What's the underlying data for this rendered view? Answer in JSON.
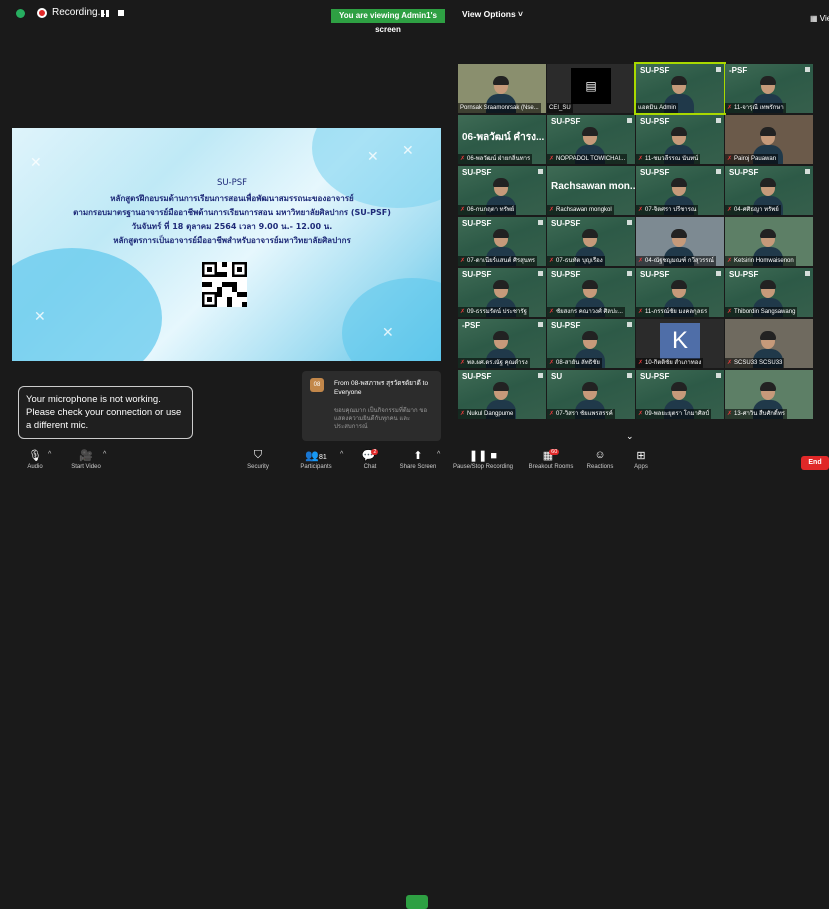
{
  "topbar": {
    "recording_label": "Recording...",
    "viewing_banner": "You are viewing Admin1's screen",
    "view_options": "View Options ˅",
    "view_right": "View"
  },
  "slide": {
    "code": "SU-PSF",
    "line1": "หลักสูตรฝึกอบรมด้านการเรียนการสอนเพื่อพัฒนาสมรรถนะของอาจารย์",
    "line2": "ตามกรอบมาตรฐานอาจารย์มืออาชีพด้านการเรียนการสอน มหาวิทยาลัยศิลปากร (SU-PSF)",
    "line3": "วันจันทร์ ที่ 18 ตุลาคม 2564 เวลา 9.00 น.- 12.00 น.",
    "line4": "หลักสูตรการเป็นอาจารย์มืออาชีพสำหรับอาจารย์มหาวิทยาลัยศิลปากร"
  },
  "participants": [
    {
      "label": "Pornsak Sraamonrsak (Nse...",
      "bg": "photo",
      "top": ""
    },
    {
      "label": "CEI_SU",
      "bg": "logo",
      "top": ""
    },
    {
      "label": "แอดมิน Admin",
      "bg": "green",
      "top": "SU-PSF"
    },
    {
      "label": "11-จารุณี เทพรักษา",
      "bg": "green",
      "top": "-PSF",
      "mic_off": true
    },
    {
      "label": "06-พลวัฒน์ ฝ่ายกลิ่นทาร",
      "bg": "name",
      "big": "06-พลวัฒน์ คำรง...",
      "mic_off": true
    },
    {
      "label": "NOPPADOL TOWICHAI...",
      "bg": "green",
      "top": "SU-PSF",
      "mic_off": true
    },
    {
      "label": "11-ชมวลีรรณ นันทน์",
      "bg": "green",
      "top": "SU-PSF",
      "mic_off": true
    },
    {
      "label": "Pairoj Pauawan",
      "bg": "photo",
      "top": "",
      "mic_off": true
    },
    {
      "label": "06-กนกฤตา ทรัพย์",
      "bg": "green",
      "top": "SU-PSF",
      "mic_off": true
    },
    {
      "label": "Rachsawan mongkol",
      "bg": "name",
      "big": "Rachsawan mon...",
      "mic_off": true
    },
    {
      "label": "07-จิตศรา ปรีชารณ",
      "bg": "green",
      "top": "SU-PSF",
      "mic_off": true
    },
    {
      "label": "04-ศศิธญา ทรัพย์",
      "bg": "green",
      "top": "SU-PSF",
      "mic_off": true
    },
    {
      "label": "07-ดาเนียร์แสนต์ ศิรสุนทร",
      "bg": "green",
      "top": "SU-PSF",
      "mic_off": true
    },
    {
      "label": "07-ธนทัต บุญเรือง",
      "bg": "green",
      "top": "SU-PSF",
      "mic_off": true
    },
    {
      "label": "04-ณัฐชญมณฑ์ กวีสุวรรณ์",
      "bg": "photo",
      "top": "",
      "mic_off": true
    },
    {
      "label": "Ketsirin Homwaisenon",
      "bg": "photo",
      "top": "",
      "mic_off": true
    },
    {
      "label": "09-ธรรมรัตน์ ประชารัฐ",
      "bg": "green",
      "top": "SU-PSF",
      "mic_off": true
    },
    {
      "label": "ชัยสงกร คณาวงศ์ ศิลปะ...",
      "bg": "green",
      "top": "SU-PSF",
      "mic_off": true
    },
    {
      "label": "11-ภรรณ์ชัย มงคลกุลธร",
      "bg": "green",
      "top": "SU-PSF",
      "mic_off": true
    },
    {
      "label": "Thibordin Sangsawang",
      "bg": "green",
      "top": "SU-PSF",
      "mic_off": true
    },
    {
      "label": "พล.ผศ.ดร.ณัฐ คุณดำรง",
      "bg": "green",
      "top": "-PSF",
      "mic_off": true
    },
    {
      "label": "08-สายัน ลัทธิชัย",
      "bg": "green",
      "top": "SU-PSF",
      "mic_off": true
    },
    {
      "label": "10-กิตติชัย สำเภาทอง",
      "bg": "k",
      "top": "",
      "mic_off": true
    },
    {
      "label": "SCSU33 SCSU33",
      "bg": "photo",
      "top": "",
      "mic_off": true
    },
    {
      "label": "Nukul Dangpume",
      "bg": "green",
      "top": "SU-PSF",
      "mic_off": true
    },
    {
      "label": "07-วิสรา ชัยแพรสรรค์",
      "bg": "green",
      "top": "SU",
      "mic_off": true
    },
    {
      "label": "09-พลยะยุตรา โกมาศิลป์",
      "bg": "green",
      "top": "SU-PSF",
      "mic_off": true
    },
    {
      "label": "13-ศาวิน สืบศักดิ์ทร",
      "bg": "photo",
      "top": "",
      "mic_off": true
    }
  ],
  "mic_warning": "Your microphone is not working. Please check your connection or use a different mic.",
  "chat": {
    "avatar_text": "08",
    "from": "From 08-พสภาพร สุรวัดรดัยาดี to Everyone",
    "message": "ขอบคุณมาก เป็นกิจกรรมที่ดีมาก ขอแสดงความยินดีกับทุกคน และประสบการณ์"
  },
  "toolbar": {
    "audio": "Audio",
    "stop_video": "Start Video",
    "security": "Security",
    "participants": "Participants",
    "participants_count": "81",
    "chat": "Chat",
    "chat_badge": "2",
    "share_screen": "Share Screen",
    "record": "Pause/Stop Recording",
    "breakout": "Breakout Rooms",
    "breakout_badge": "60",
    "reactions": "Reactions",
    "apps": "Apps",
    "end": "End"
  }
}
